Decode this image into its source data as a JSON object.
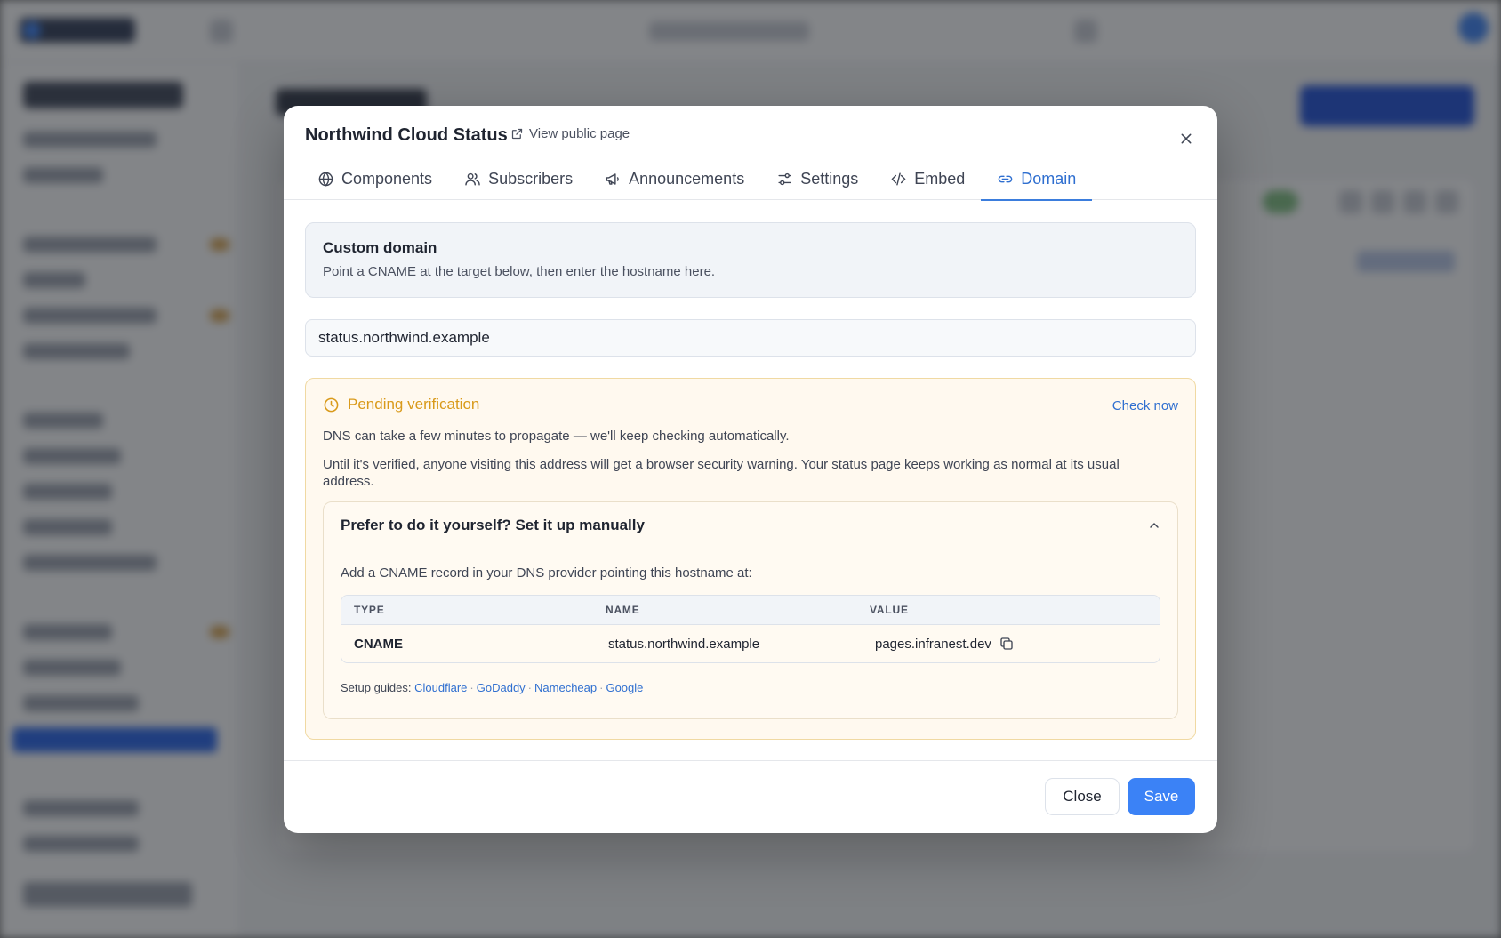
{
  "modal": {
    "title": "Northwind Cloud Status",
    "view_public_label": "View public page"
  },
  "tabs": [
    {
      "label": "Components",
      "icon": "globe-icon"
    },
    {
      "label": "Subscribers",
      "icon": "users-icon"
    },
    {
      "label": "Announcements",
      "icon": "megaphone-icon"
    },
    {
      "label": "Settings",
      "icon": "sliders-icon"
    },
    {
      "label": "Embed",
      "icon": "code-icon"
    },
    {
      "label": "Domain",
      "icon": "link-icon",
      "active": true
    }
  ],
  "custom_domain": {
    "title": "Custom domain",
    "subtitle": "Point a CNAME at the target below, then enter the hostname here."
  },
  "hostname": {
    "value": "status.northwind.example"
  },
  "pending": {
    "title": "Pending verification",
    "check_now_label": "Check now",
    "line1": "DNS can take a few minutes to propagate — we'll keep checking automatically.",
    "line2": "Until it's verified, anyone visiting this address will get a browser security warning. Your status page keeps working as normal at its usual address."
  },
  "manual": {
    "title": "Prefer to do it yourself? Set it up manually",
    "intro": "Add a CNAME record in your DNS provider pointing this hostname at:",
    "table": {
      "headers": [
        "TYPE",
        "NAME",
        "VALUE"
      ],
      "row": {
        "type": "CNAME",
        "name": "status.northwind.example",
        "value": "pages.infranest.dev"
      }
    },
    "guides_label": "Setup guides:",
    "guides": [
      "Cloudflare",
      "GoDaddy",
      "Namecheap",
      "Google"
    ]
  },
  "footer": {
    "close_label": "Close",
    "save_label": "Save"
  },
  "colors": {
    "accent": "#3b82f6",
    "link": "#2f6fd0",
    "pending": "#d99a1a",
    "pending_bg": "#fff9ef"
  }
}
